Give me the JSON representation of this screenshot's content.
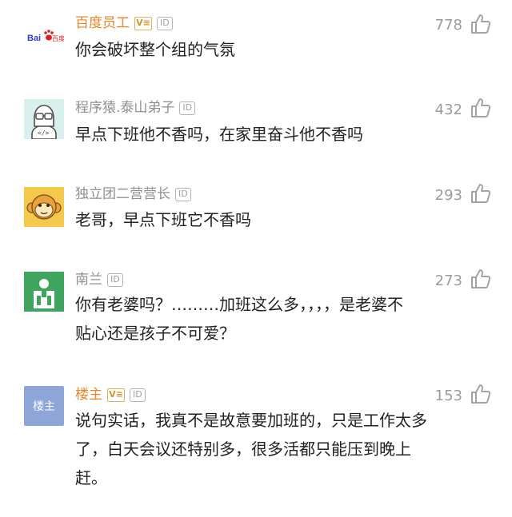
{
  "comments": [
    {
      "user": "百度员工",
      "vip": "V≡",
      "id_badge": "ID",
      "likes": "778",
      "text": "你会破坏整个组的气氛",
      "avatar_text": "Bai百度"
    },
    {
      "user": "程序猿.泰山弟子",
      "id_badge": "ID",
      "likes": "432",
      "text": "早点下班他不香吗，在家里奋斗他不香吗",
      "avatar_text": "</>"
    },
    {
      "user": "独立团二营营长",
      "id_badge": "ID",
      "likes": "293",
      "text": "老哥，早点下班它不香吗"
    },
    {
      "user": "南兰",
      "id_badge": "ID",
      "likes": "273",
      "text_lines": [
        "你有老婆吗？………加班这么多，，，，是老婆不",
        "贴心还是孩子不可爱？"
      ]
    },
    {
      "user": "楼主",
      "vip": "V≡",
      "id_badge": "ID",
      "likes": "153",
      "text_lines": [
        "说句实话，我真不是故意要加班的，只是工作太多",
        "了，白天会议还特别多，很多活都只能压到晚上",
        "赶。"
      ],
      "avatar_text": "楼主"
    }
  ],
  "colors": {
    "username_orange": "#e8862c",
    "username_gray": "#8f8f8f",
    "vip_gold": "#d9b25a",
    "likes_gray": "#9b9b9b",
    "text": "#222222",
    "thumb_gray": "#a3a3a3"
  },
  "icons": [
    "baidu-logo-icon",
    "coder-avatar-icon",
    "monkey-avatar-icon",
    "person-avatar-icon",
    "thumbs-up-icon"
  ]
}
